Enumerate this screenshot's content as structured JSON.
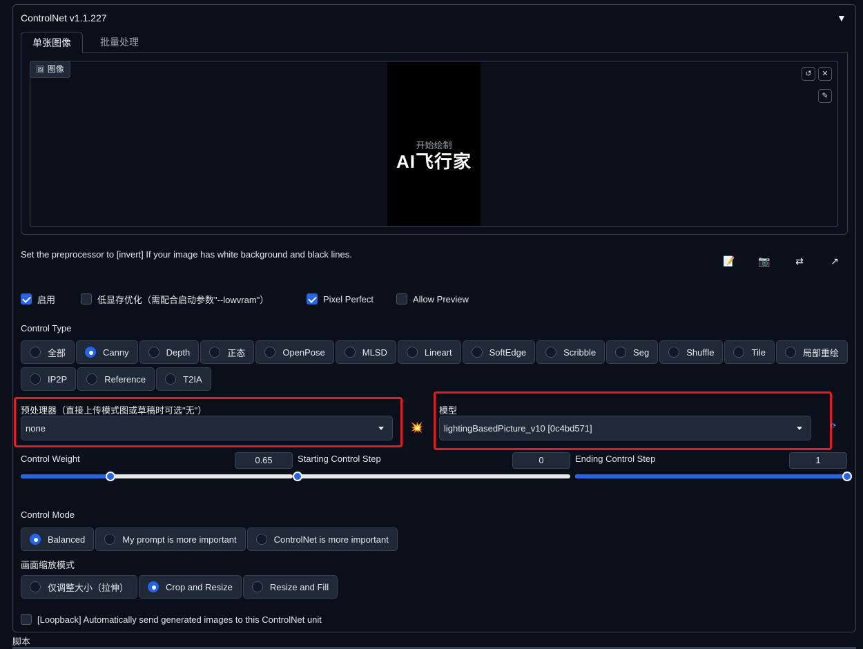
{
  "header": {
    "title": "ControlNet v1.1.227",
    "collapse_icon": "▼"
  },
  "tabs": [
    {
      "label": "单张图像"
    },
    {
      "label": "批量处理"
    }
  ],
  "image": {
    "label": "图像",
    "canvas_hint": "开始绘制",
    "watermark": "AI飞行家",
    "icons": [
      "undo-icon",
      "close-icon",
      "brush-icon"
    ]
  },
  "hint_text": "Set the preprocessor to [invert] If your image has white background and black lines.",
  "tool_icons": [
    "edit-icon",
    "camera-icon",
    "swap-icon",
    "send-icon"
  ],
  "options": [
    {
      "label": "启用",
      "checked": true
    },
    {
      "label": "低显存优化（需配合启动参数\"--lowvram\"）",
      "checked": false
    },
    {
      "label": "Pixel Perfect",
      "checked": true
    },
    {
      "label": "Allow Preview",
      "checked": false
    }
  ],
  "control_type": {
    "label": "Control Type",
    "items": [
      "全部",
      "Canny",
      "Depth",
      "正态",
      "OpenPose",
      "MLSD",
      "Lineart",
      "SoftEdge",
      "Scribble",
      "Seg",
      "Shuffle",
      "Tile",
      "局部重绘",
      "IP2P",
      "Reference",
      "T2IA"
    ],
    "selected": "Canny"
  },
  "preprocessor": {
    "label": "预处理器（直接上传模式图或草稿时可选\"无\"）",
    "value": "none"
  },
  "run_icon": "💥",
  "model": {
    "label": "模型",
    "value": "lightingBasedPicture_v10 [0c4bd571]",
    "refresh_icon": "refresh-icon"
  },
  "sliders": {
    "weight": {
      "label": "Control Weight",
      "value": "0.65",
      "fraction": 0.33
    },
    "start": {
      "label": "Starting Control Step",
      "value": "0",
      "fraction": 0.0
    },
    "end": {
      "label": "Ending Control Step",
      "value": "1",
      "fraction": 1.0
    }
  },
  "control_mode": {
    "label": "Control Mode",
    "items": [
      "Balanced",
      "My prompt is more important",
      "ControlNet is more important"
    ],
    "selected": "Balanced"
  },
  "resize_mode": {
    "label": "画面缩放模式",
    "items": [
      "仅调整大小（拉伸）",
      "Crop and Resize",
      "Resize and Fill"
    ],
    "selected": "Crop and Resize"
  },
  "loopback": {
    "label": "[Loopback] Automatically send generated images to this ControlNet unit",
    "checked": false
  },
  "script_label": "脚本"
}
